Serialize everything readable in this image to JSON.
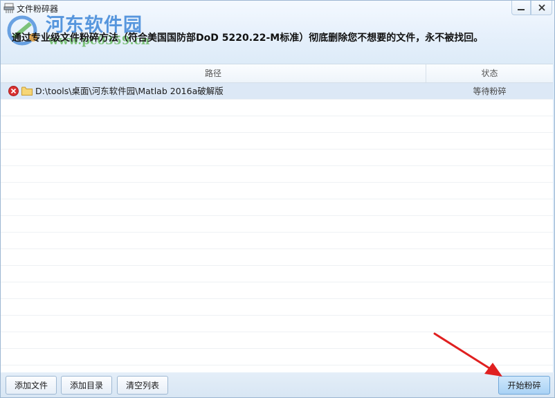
{
  "window": {
    "title": "文件粉碎器",
    "headline": "通过专业级文件粉碎方法（符合美国国防部DoD 5220.22-M标准）彻底删除您不想要的文件，永不被找回。",
    "watermark_name": "河东软件园",
    "watermark_url": "www.pc0359.cn"
  },
  "list": {
    "columns": {
      "path": "路径",
      "status": "状态"
    },
    "rows": [
      {
        "path": "D:\\tools\\桌面\\河东软件园\\Matlab 2016a破解版",
        "status": "等待粉碎"
      }
    ]
  },
  "footer": {
    "add_file": "添加文件",
    "add_dir": "添加目录",
    "clear_list": "清空列表",
    "start": "开始粉碎"
  },
  "colors": {
    "accent": "#3d86d8",
    "arrow": "#e02020",
    "delete": "#d93030"
  },
  "icons": [
    "shredder-icon",
    "minimize-icon",
    "close-icon",
    "delete-icon",
    "folder-icon"
  ]
}
